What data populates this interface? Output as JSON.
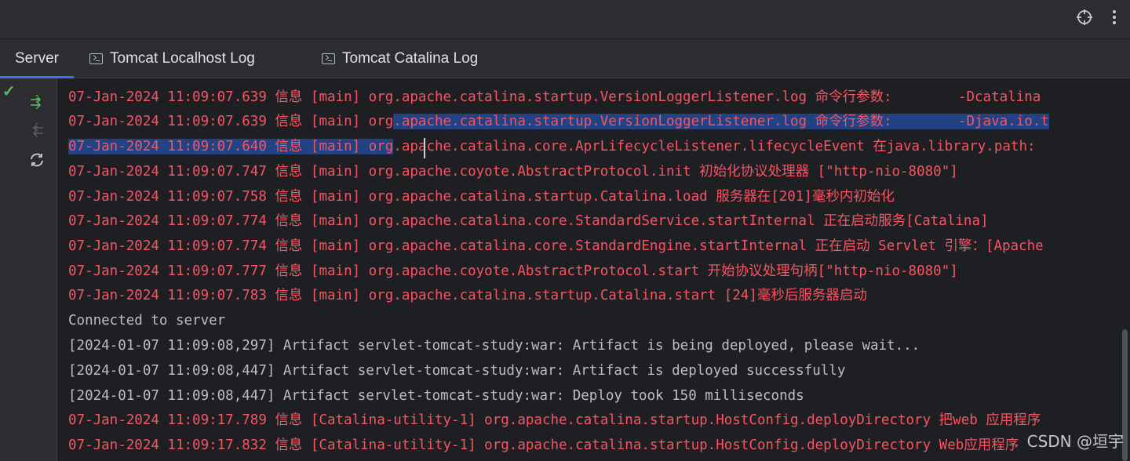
{
  "top_toolbar": {
    "target_icon": "crosshair-icon",
    "more_icon": "vertical-ellipsis-icon"
  },
  "tabs": [
    {
      "label": "Server",
      "active": true
    },
    {
      "label": "Tomcat Localhost Log",
      "icon": "terminal-icon"
    },
    {
      "label": "Tomcat Catalina Log",
      "icon": "terminal-icon"
    }
  ],
  "sidebar": {
    "status_icon": "checkmark-icon",
    "tools": [
      "deploy-all-icon",
      "undeploy-icon",
      "refresh-icon"
    ]
  },
  "colors": {
    "error_text": "#f75464",
    "normal_text": "#bcbec4",
    "selection": "#214283",
    "active_tab_underline": "#3574f0",
    "status_ok": "#5fb865"
  },
  "console": {
    "lines": [
      {
        "pre": "",
        "sel": "",
        "post": "07-Jan-2024 11:09:07.639 信息 [main] org.apache.catalina.startup.VersionLoggerListener.log 命令行参数:        -Dcatalina",
        "color": "red"
      },
      {
        "pre": "07-Jan-2024 11:09:07.639 信息 [main] org",
        "sel": ".apache.catalina.startup.VersionLoggerListener.log 命令行参数:        -Djava.io.t",
        "post": "",
        "color": "red"
      },
      {
        "pre": "",
        "sel": "07-Jan-2024 11:09:07.640 信息 [main] org",
        "post": ".apache.catalina.core.AprLifecycleListener.lifecycleEvent 在java.library.path:",
        "color": "red"
      },
      {
        "pre": "",
        "sel": "",
        "post": "07-Jan-2024 11:09:07.747 信息 [main] org.apache.coyote.AbstractProtocol.init 初始化协议处理器 [\"http-nio-8080\"]",
        "color": "red"
      },
      {
        "pre": "",
        "sel": "",
        "post": "07-Jan-2024 11:09:07.758 信息 [main] org.apache.catalina.startup.Catalina.load 服务器在[201]毫秒内初始化",
        "color": "red"
      },
      {
        "pre": "",
        "sel": "",
        "post": "07-Jan-2024 11:09:07.774 信息 [main] org.apache.catalina.core.StandardService.startInternal 正在启动服务[Catalina]",
        "color": "red"
      },
      {
        "pre": "",
        "sel": "",
        "post": "07-Jan-2024 11:09:07.774 信息 [main] org.apache.catalina.core.StandardEngine.startInternal 正在启动 Servlet 引擎：[Apache",
        "color": "red"
      },
      {
        "pre": "",
        "sel": "",
        "post": "07-Jan-2024 11:09:07.777 信息 [main] org.apache.coyote.AbstractProtocol.start 开始协议处理句柄[\"http-nio-8080\"]",
        "color": "red"
      },
      {
        "pre": "",
        "sel": "",
        "post": "07-Jan-2024 11:09:07.783 信息 [main] org.apache.catalina.startup.Catalina.start [24]毫秒后服务器启动",
        "color": "red"
      },
      {
        "pre": "",
        "sel": "",
        "post": "Connected to server",
        "color": "white"
      },
      {
        "pre": "",
        "sel": "",
        "post": "[2024-01-07 11:09:08,297] Artifact servlet-tomcat-study:war: Artifact is being deployed, please wait...",
        "color": "white"
      },
      {
        "pre": "",
        "sel": "",
        "post": "[2024-01-07 11:09:08,447] Artifact servlet-tomcat-study:war: Artifact is deployed successfully",
        "color": "white"
      },
      {
        "pre": "",
        "sel": "",
        "post": "[2024-01-07 11:09:08,447] Artifact servlet-tomcat-study:war: Deploy took 150 milliseconds",
        "color": "white"
      },
      {
        "pre": "",
        "sel": "",
        "post": "07-Jan-2024 11:09:17.789 信息 [Catalina-utility-1] org.apache.catalina.startup.HostConfig.deployDirectory 把web 应用程序",
        "color": "red"
      },
      {
        "pre": "",
        "sel": "",
        "post": "07-Jan-2024 11:09:17.832 信息 [Catalina-utility-1] org.apache.catalina.startup.HostConfig.deployDirectory Web应用程序",
        "color": "red"
      }
    ]
  },
  "watermark": "CSDN @垣宇"
}
